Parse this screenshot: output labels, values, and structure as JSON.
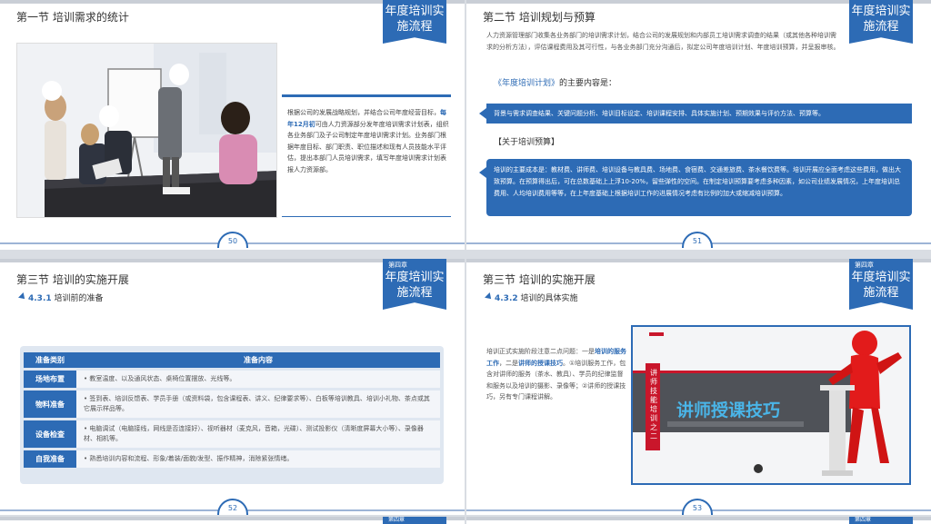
{
  "slide1": {
    "title": "第一节  培训需求的统计",
    "tag_big": "年度培训实施流程",
    "text_1": "根据公司的发展战略规划，并结合公司年度经营目标，",
    "text_bold": "每年12月初",
    "text_2": "可由人力资源部分发年度培训需求计划表，组织各业务部门及子公司制定年度培训需求计划。业务部门根据年度目标、部门职责、职位描述和现有人员技能水平评估，提出本部门人员培训需求，填写年度培训需求计划表报人力资源部。",
    "page": "50"
  },
  "slide2": {
    "title": "第二节  培训规划与预算",
    "tag_big": "年度培训实施流程",
    "intro": "人力资源管理部门收集各业务部门的培训需求计划，结合公司的发展规划和内部员工培训需求调查的结果（或其他各种培训需求的分析方法），评估课程费用及其可行性，与各业务部门充分沟通后，拟定公司年度培训计划、年度培训预算，并呈报审核。",
    "sub_em": "《年度培训计划》",
    "sub_rest": "的主要内容是：",
    "box1": "背景与需求调查结果、关键问题分析、培训目标设定、培训课程安排、具体实施计划、预期效果与评价方法、预算等。",
    "sub2": "【关于培训预算】",
    "box2": "培训的主要成本是：教材费、讲师费、培训设备与教具费、场地费、食宿费、交通差旅费、茶水餐饮费等。培训开展应全面考虑这些费用，做出大致预算。在预算得出后，可在总数基础上上浮10-20%，留些弹性的空间。在制定培训预算要考虑多种因素，如公司业绩发展情况，上年度培训总费用、人均培训费用等等，在上年度基础上根据培训工作的进展情况考虑有比例的加大或缩减培训预算。",
    "page": "51"
  },
  "slide3": {
    "title": "第三节  培训的实施开展",
    "tag_small": "第四章",
    "tag_big": "年度培训实施流程",
    "sub_num": "4.3.1",
    "sub_text": "培训前的准备",
    "col1": "准备类别",
    "col2": "准备内容",
    "rows": [
      {
        "cat": "场地布置",
        "content": "教室温度、以及通风状态、桌椅位置摆放、光线等。"
      },
      {
        "cat": "物料准备",
        "content": "签到表、培训反馈表、学员手册（或资料袋，包含课程表、讲义、纪律要求等）、白板等培训教具、培训小礼物、茶点或其它展示样品等。"
      },
      {
        "cat": "设备检查",
        "content": "电脑调试（电脑接线，网线是否连接好）、视听器材（麦克风，音箱，光碟）、测试投影仪（清晰度屏幕大小等）、录像器材、相机等。"
      },
      {
        "cat": "自我准备",
        "content": "熟悉培训内容和流程、形象/着装/面貌/发型、振作精神，消除紧张情绪。"
      }
    ],
    "page": "52"
  },
  "slide4": {
    "title": "第三节  培训的实施开展",
    "tag_small": "第四章",
    "tag_big": "年度培训实施流程",
    "sub_num": "4.3.2",
    "sub_text": "培训的具体实施",
    "text_1": "培训正式实施阶段注意二点问题：一是",
    "text_b1": "培训的服务工作",
    "text_2": "，二是",
    "text_b2": "讲师的授课技巧",
    "text_3": "。①培训服务工作，包含对讲师的服务（茶水、教具）、学员的纪律监督和服务以及培训的摄影、录像等；②讲师的授课技巧，另有专门课程讲解。",
    "cover_vert": "讲师技能培训之二",
    "cover_title": "讲师授课技巧",
    "page": "53"
  },
  "peek": {
    "tag_small": "第四章"
  },
  "colors": {
    "accent": "#2d6bb5"
  }
}
